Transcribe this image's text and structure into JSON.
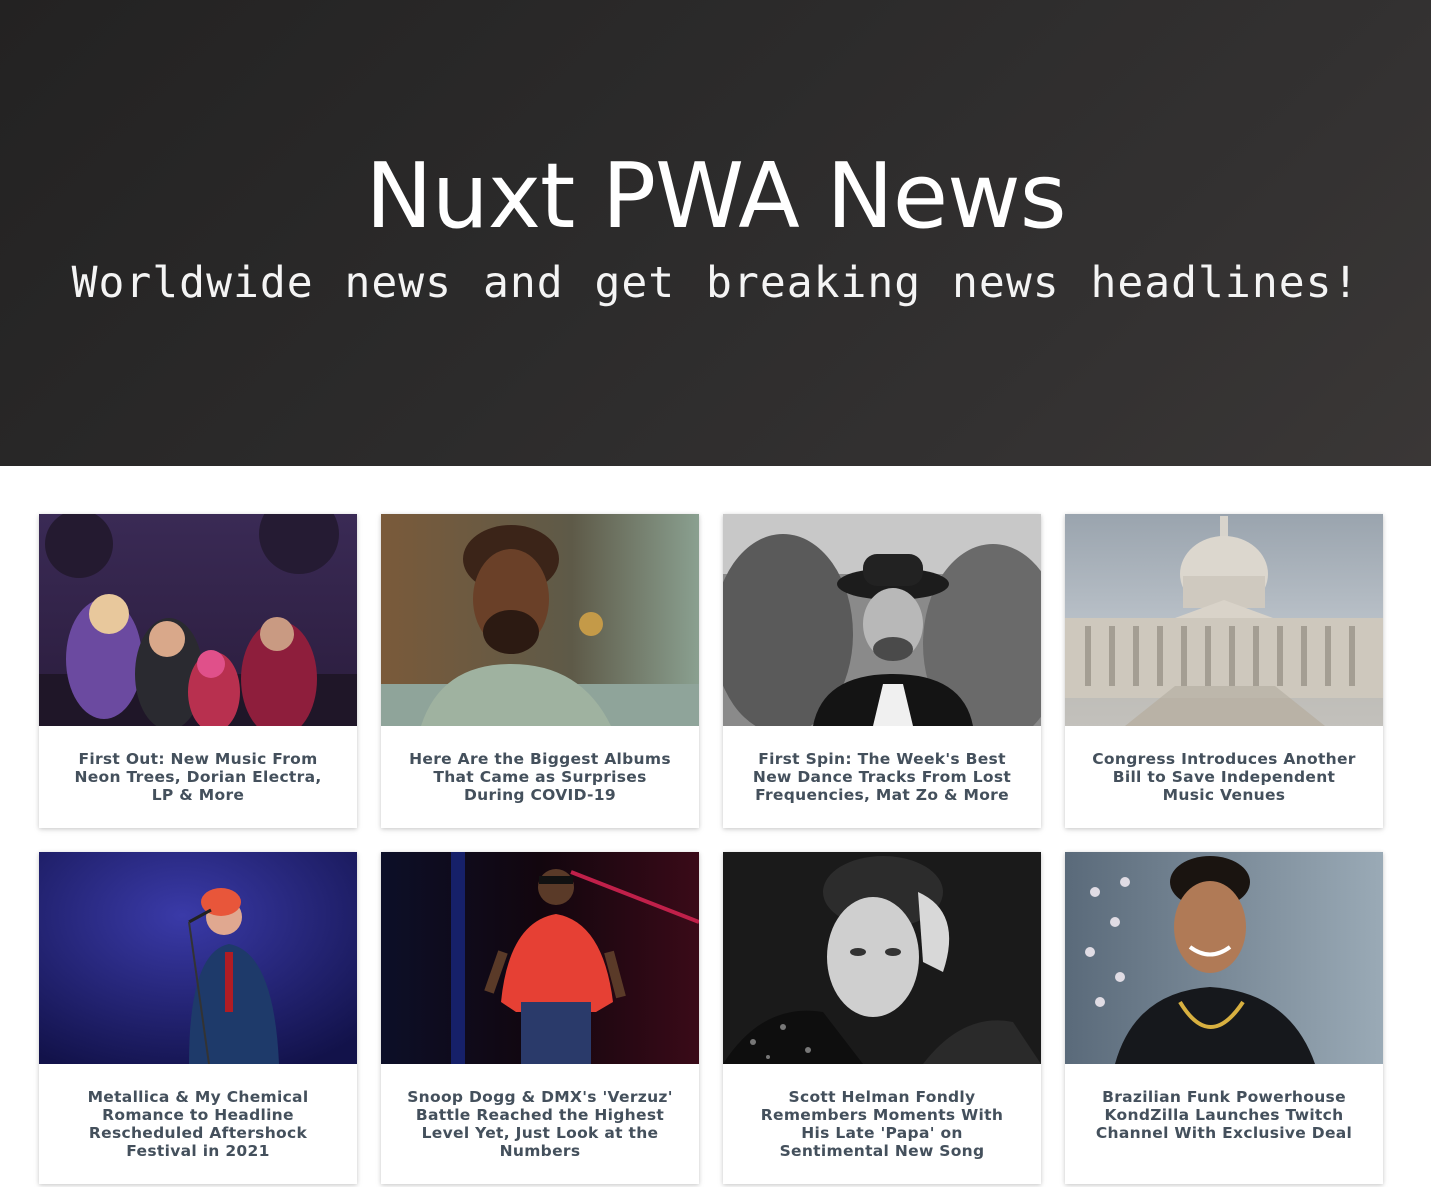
{
  "hero": {
    "title": "Nuxt PWA News",
    "subtitle": "Worldwide news and get breaking news headlines!"
  },
  "articles": [
    {
      "title": "First Out: New Music From Neon Trees, Dorian Electra, LP & More",
      "image": "band-photo"
    },
    {
      "title": "Here Are the Biggest Albums That Came as Surprises During COVID-19",
      "image": "portrait-photo"
    },
    {
      "title": "First Spin: The Week's Best New Dance Tracks From Lost Frequencies, Mat Zo & More",
      "image": "dj-portrait-photo"
    },
    {
      "title": "Congress Introduces Another Bill to Save Independent Music Venues",
      "image": "capitol-building-photo"
    },
    {
      "title": "Metallica & My Chemical Romance to Headline Rescheduled Aftershock Festival in 2021",
      "image": "singer-on-stage-photo"
    },
    {
      "title": "Snoop Dogg & DMX's 'Verzuz' Battle Reached the Highest Level Yet, Just Look at the Numbers",
      "image": "rapper-on-stage-photo"
    },
    {
      "title": "Scott Helman Fondly Remembers Moments With His Late 'Papa' on Sentimental New Song",
      "image": "bw-portrait-photo"
    },
    {
      "title": "Brazilian Funk Powerhouse KondZilla Launches Twitch Channel With Exclusive Deal",
      "image": "smiling-man-photo"
    }
  ]
}
